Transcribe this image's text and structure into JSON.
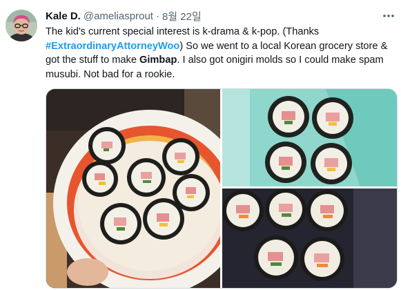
{
  "user": {
    "name": "Kale D.",
    "handle": "@ameliasprout",
    "separator": "·",
    "date": "8월 22일"
  },
  "tweet": {
    "text_1": "The kid's current special interest is k-drama & k-pop.  (Thanks ",
    "hashtag": "#ExtraordinaryAttorneyWoo",
    "text_2": ") So we went to a local Korean grocery store & got the stuff to make ",
    "bold_word": "Gimbap",
    "text_3": ".  I also got onigiri molds so I could make spam musubi.  Not bad for a rookie."
  },
  "icons": {
    "more": "more-horizontal-icon",
    "avatar": "avatar"
  },
  "media": {
    "count": 3
  },
  "colors": {
    "link": "#1d9bf0",
    "text": "#0f1419",
    "muted": "#536471",
    "border": "#cfd9de"
  }
}
